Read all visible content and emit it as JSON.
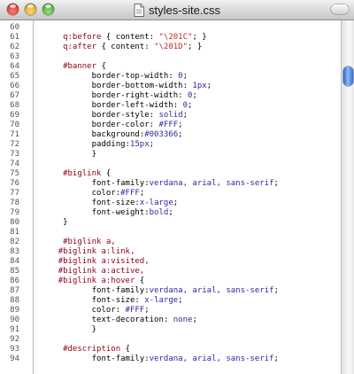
{
  "window": {
    "title": "styles-site.css"
  },
  "editor": {
    "lines": [
      {
        "num": "60",
        "tokens": []
      },
      {
        "num": "61",
        "tokens": [
          {
            "t": "q:before",
            "c": "sel"
          },
          {
            "t": " { ",
            "c": "punc"
          },
          {
            "t": "content",
            "c": "prop"
          },
          {
            "t": ": ",
            "c": "punc"
          },
          {
            "t": "\"\\201C\"",
            "c": "str"
          },
          {
            "t": "; }",
            "c": "punc"
          }
        ],
        "indent": 5
      },
      {
        "num": "62",
        "tokens": [
          {
            "t": "q:after",
            "c": "sel"
          },
          {
            "t": " { ",
            "c": "punc"
          },
          {
            "t": "content",
            "c": "prop"
          },
          {
            "t": ": ",
            "c": "punc"
          },
          {
            "t": "\"\\201D\"",
            "c": "str"
          },
          {
            "t": "; }",
            "c": "punc"
          }
        ],
        "indent": 5
      },
      {
        "num": "63",
        "tokens": []
      },
      {
        "num": "64",
        "tokens": [
          {
            "t": "#banner",
            "c": "sel"
          },
          {
            "t": " {",
            "c": "punc"
          }
        ],
        "indent": 5
      },
      {
        "num": "65",
        "tokens": [
          {
            "t": "border-top-width",
            "c": "prop"
          },
          {
            "t": ": ",
            "c": "punc"
          },
          {
            "t": "0",
            "c": "val"
          },
          {
            "t": ";",
            "c": "punc"
          }
        ],
        "indent": 11
      },
      {
        "num": "66",
        "tokens": [
          {
            "t": "border-bottom-width",
            "c": "prop"
          },
          {
            "t": ": ",
            "c": "punc"
          },
          {
            "t": "1px",
            "c": "val"
          },
          {
            "t": ";",
            "c": "punc"
          }
        ],
        "indent": 11
      },
      {
        "num": "67",
        "tokens": [
          {
            "t": "border-right-width",
            "c": "prop"
          },
          {
            "t": ": ",
            "c": "punc"
          },
          {
            "t": "0",
            "c": "val"
          },
          {
            "t": ";",
            "c": "punc"
          }
        ],
        "indent": 11
      },
      {
        "num": "68",
        "tokens": [
          {
            "t": "border-left-width",
            "c": "prop"
          },
          {
            "t": ": ",
            "c": "punc"
          },
          {
            "t": "0",
            "c": "val"
          },
          {
            "t": ";",
            "c": "punc"
          }
        ],
        "indent": 11
      },
      {
        "num": "69",
        "tokens": [
          {
            "t": "border-style",
            "c": "prop"
          },
          {
            "t": ": ",
            "c": "punc"
          },
          {
            "t": "solid",
            "c": "val"
          },
          {
            "t": ";",
            "c": "punc"
          }
        ],
        "indent": 11
      },
      {
        "num": "70",
        "tokens": [
          {
            "t": "border-color",
            "c": "prop"
          },
          {
            "t": ": ",
            "c": "punc"
          },
          {
            "t": "#FFF",
            "c": "val"
          },
          {
            "t": ";",
            "c": "punc"
          }
        ],
        "indent": 11
      },
      {
        "num": "71",
        "tokens": [
          {
            "t": "background",
            "c": "prop"
          },
          {
            "t": ":",
            "c": "punc"
          },
          {
            "t": "#003366",
            "c": "val"
          },
          {
            "t": ";",
            "c": "punc"
          }
        ],
        "indent": 11
      },
      {
        "num": "72",
        "tokens": [
          {
            "t": "padding",
            "c": "prop"
          },
          {
            "t": ":",
            "c": "punc"
          },
          {
            "t": "15px",
            "c": "val"
          },
          {
            "t": ";",
            "c": "punc"
          }
        ],
        "indent": 11
      },
      {
        "num": "73",
        "tokens": [
          {
            "t": "}",
            "c": "punc"
          }
        ],
        "indent": 11
      },
      {
        "num": "74",
        "tokens": []
      },
      {
        "num": "75",
        "tokens": [
          {
            "t": "#biglink",
            "c": "sel"
          },
          {
            "t": " {",
            "c": "punc"
          }
        ],
        "indent": 5
      },
      {
        "num": "76",
        "tokens": [
          {
            "t": "font-family",
            "c": "prop"
          },
          {
            "t": ":",
            "c": "punc"
          },
          {
            "t": "verdana, arial, sans-serif",
            "c": "val"
          },
          {
            "t": ";",
            "c": "punc"
          }
        ],
        "indent": 11
      },
      {
        "num": "77",
        "tokens": [
          {
            "t": "color",
            "c": "prop"
          },
          {
            "t": ":",
            "c": "punc"
          },
          {
            "t": "#FFF",
            "c": "val"
          },
          {
            "t": ";",
            "c": "punc"
          }
        ],
        "indent": 11
      },
      {
        "num": "78",
        "tokens": [
          {
            "t": "font-size",
            "c": "prop"
          },
          {
            "t": ":",
            "c": "punc"
          },
          {
            "t": "x-large",
            "c": "val"
          },
          {
            "t": ";",
            "c": "punc"
          }
        ],
        "indent": 11
      },
      {
        "num": "79",
        "tokens": [
          {
            "t": "font-weight",
            "c": "prop"
          },
          {
            "t": ":",
            "c": "punc"
          },
          {
            "t": "bold",
            "c": "val"
          },
          {
            "t": ";",
            "c": "punc"
          }
        ],
        "indent": 11
      },
      {
        "num": "80",
        "tokens": [
          {
            "t": "}",
            "c": "punc"
          }
        ],
        "indent": 5
      },
      {
        "num": "81",
        "tokens": []
      },
      {
        "num": "82",
        "tokens": [
          {
            "t": "#biglink a,",
            "c": "sel"
          }
        ],
        "indent": 5
      },
      {
        "num": "83",
        "tokens": [
          {
            "t": "#biglink a:link,",
            "c": "sel"
          }
        ],
        "indent": 4
      },
      {
        "num": "84",
        "tokens": [
          {
            "t": "#biglink a:visited,",
            "c": "sel"
          }
        ],
        "indent": 4
      },
      {
        "num": "85",
        "tokens": [
          {
            "t": "#biglink a:active,",
            "c": "sel"
          }
        ],
        "indent": 4
      },
      {
        "num": "86",
        "tokens": [
          {
            "t": "#biglink a:hover",
            "c": "sel"
          },
          {
            "t": " {",
            "c": "punc"
          }
        ],
        "indent": 4
      },
      {
        "num": "87",
        "tokens": [
          {
            "t": "font-family",
            "c": "prop"
          },
          {
            "t": ":",
            "c": "punc"
          },
          {
            "t": "verdana, arial, sans-serif",
            "c": "val"
          },
          {
            "t": ";",
            "c": "punc"
          }
        ],
        "indent": 11
      },
      {
        "num": "88",
        "tokens": [
          {
            "t": "font-size",
            "c": "prop"
          },
          {
            "t": ": ",
            "c": "punc"
          },
          {
            "t": "x-large",
            "c": "val"
          },
          {
            "t": ";",
            "c": "punc"
          }
        ],
        "indent": 11
      },
      {
        "num": "89",
        "tokens": [
          {
            "t": "color",
            "c": "prop"
          },
          {
            "t": ": ",
            "c": "punc"
          },
          {
            "t": "#FFF",
            "c": "val"
          },
          {
            "t": ";",
            "c": "punc"
          }
        ],
        "indent": 11
      },
      {
        "num": "90",
        "tokens": [
          {
            "t": "text-decoration",
            "c": "prop"
          },
          {
            "t": ": ",
            "c": "punc"
          },
          {
            "t": "none",
            "c": "val"
          },
          {
            "t": ";",
            "c": "punc"
          }
        ],
        "indent": 11
      },
      {
        "num": "91",
        "tokens": [
          {
            "t": "}",
            "c": "punc"
          }
        ],
        "indent": 11
      },
      {
        "num": "92",
        "tokens": []
      },
      {
        "num": "93",
        "tokens": [
          {
            "t": "#description",
            "c": "sel"
          },
          {
            "t": " {",
            "c": "punc"
          }
        ],
        "indent": 5
      },
      {
        "num": "94",
        "tokens": [
          {
            "t": "font-family",
            "c": "prop"
          },
          {
            "t": ":",
            "c": "punc"
          },
          {
            "t": "verdana, arial, sans-serif",
            "c": "val"
          },
          {
            "t": ";",
            "c": "punc"
          }
        ],
        "indent": 11
      }
    ]
  },
  "icons": {
    "document": "document-icon",
    "close": "close-button",
    "minimize": "minimize-button",
    "zoom": "zoom-button"
  },
  "colors": {
    "selector": "#8b0018",
    "value": "#2a2a9c",
    "string": "#c12a2a",
    "scroll_thumb": "#3c6fd2"
  }
}
